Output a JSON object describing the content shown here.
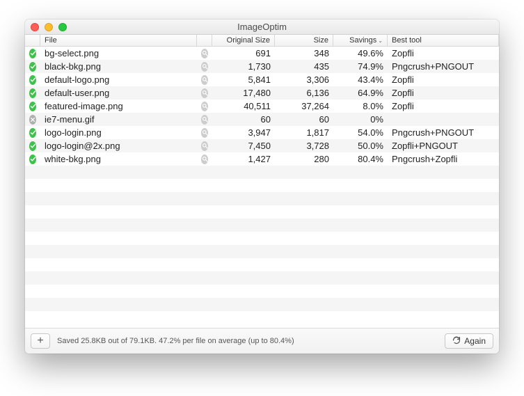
{
  "window": {
    "title": "ImageOptim"
  },
  "columns": {
    "file": "File",
    "original": "Original Size",
    "size": "Size",
    "savings": "Savings",
    "tool": "Best tool"
  },
  "rows": [
    {
      "status": "ok",
      "file": "bg-select.png",
      "original": "691",
      "size": "348",
      "savings": "49.6%",
      "tool": "Zopfli"
    },
    {
      "status": "ok",
      "file": "black-bkg.png",
      "original": "1,730",
      "size": "435",
      "savings": "74.9%",
      "tool": "Pngcrush+PNGOUT"
    },
    {
      "status": "ok",
      "file": "default-logo.png",
      "original": "5,841",
      "size": "3,306",
      "savings": "43.4%",
      "tool": "Zopfli"
    },
    {
      "status": "ok",
      "file": "default-user.png",
      "original": "17,480",
      "size": "6,136",
      "savings": "64.9%",
      "tool": "Zopfli"
    },
    {
      "status": "ok",
      "file": "featured-image.png",
      "original": "40,511",
      "size": "37,264",
      "savings": "8.0%",
      "tool": "Zopfli"
    },
    {
      "status": "fail",
      "file": "ie7-menu.gif",
      "original": "60",
      "size": "60",
      "savings": "0%",
      "tool": ""
    },
    {
      "status": "ok",
      "file": "logo-login.png",
      "original": "3,947",
      "size": "1,817",
      "savings": "54.0%",
      "tool": "Pngcrush+PNGOUT"
    },
    {
      "status": "ok",
      "file": "logo-login@2x.png",
      "original": "7,450",
      "size": "3,728",
      "savings": "50.0%",
      "tool": "Zopfli+PNGOUT"
    },
    {
      "status": "ok",
      "file": "white-bkg.png",
      "original": "1,427",
      "size": "280",
      "savings": "80.4%",
      "tool": "Pngcrush+Zopfli"
    }
  ],
  "footer": {
    "status": "Saved 25.8KB out of 79.1KB. 47.2% per file on average (up to 80.4%)",
    "add": "+",
    "again": "Again"
  }
}
